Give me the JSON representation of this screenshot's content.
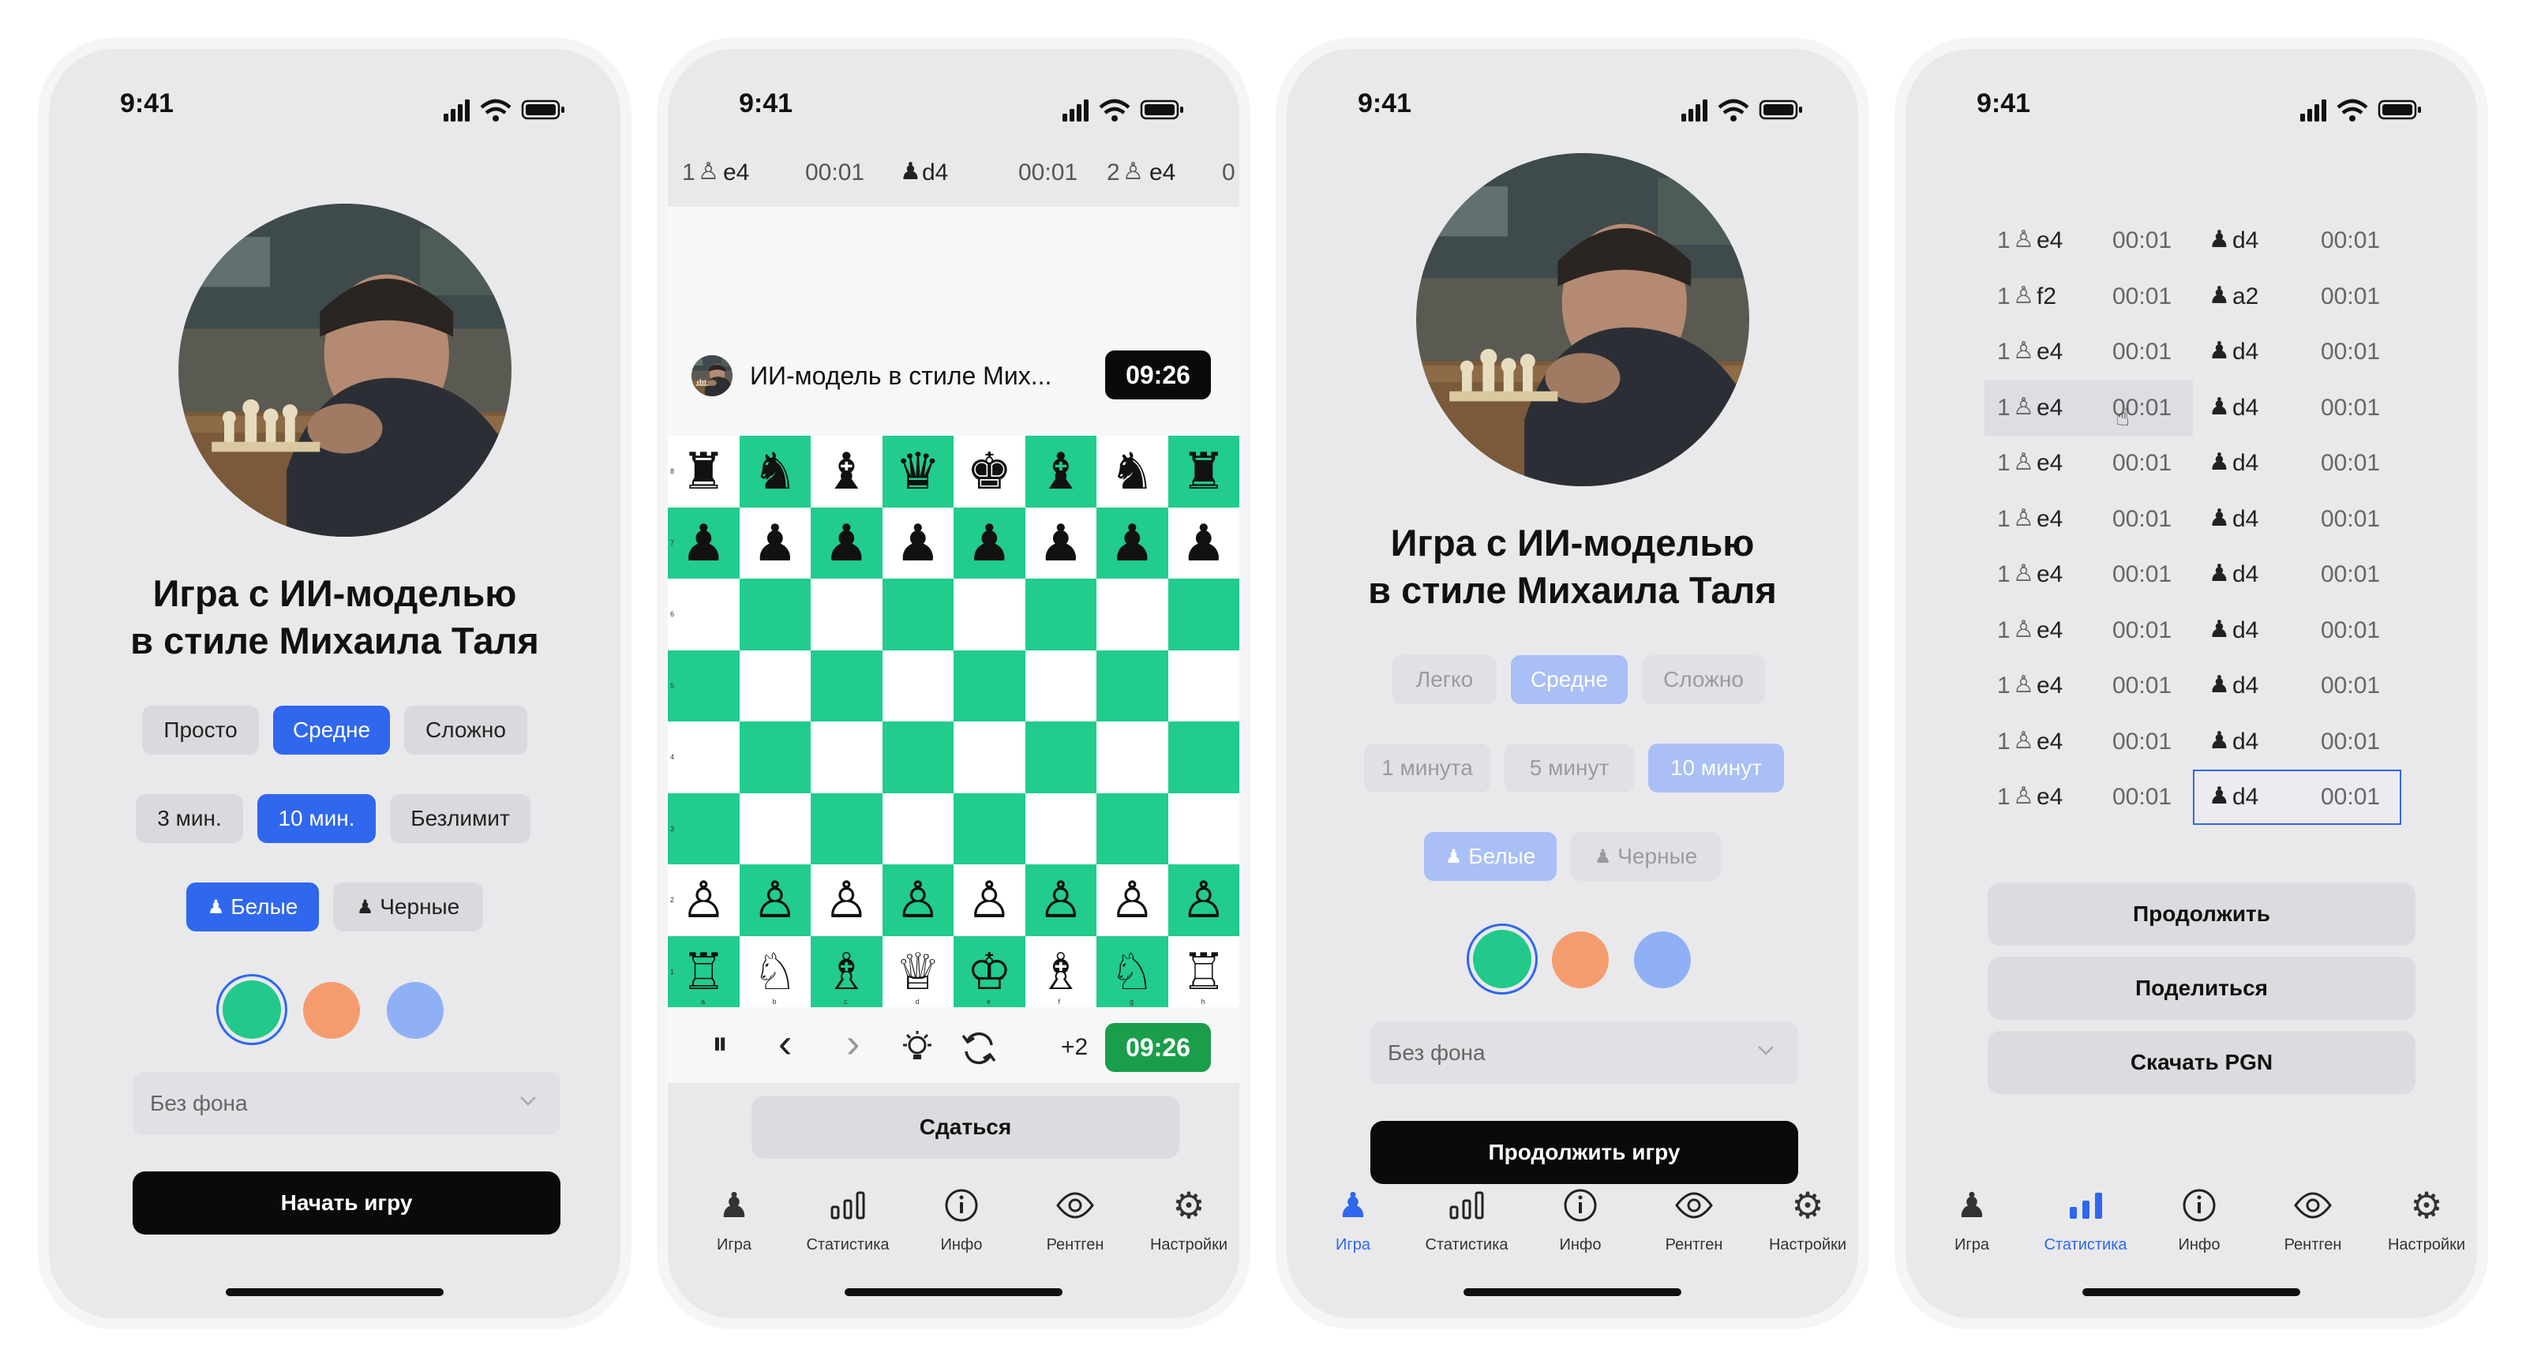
{
  "status_time": "9:41",
  "game_title_line1": "Игра с ИИ-моделью",
  "game_title_line2": "в стиле Михаила Таля",
  "screen1": {
    "difficulty": [
      "Просто",
      "Средне",
      "Сложно"
    ],
    "difficulty_selected": "Средне",
    "time": [
      "3 мин.",
      "10 мин.",
      "Безлимит"
    ],
    "time_selected": "10 мин.",
    "side": [
      "Белые",
      "Черные"
    ],
    "side_selected": "Белые",
    "colors": [
      "#22c98a",
      "#f59c6e",
      "#8fb0f5"
    ],
    "color_selected": "#22c98a",
    "background_placeholder": "Без фона",
    "start_button": "Начать игру"
  },
  "screen2": {
    "move_strip": [
      {
        "num": "1",
        "white": "e4",
        "wtime": "00:01",
        "black": "d4",
        "btime": "00:01"
      },
      {
        "num": "2",
        "white": "e4",
        "wtime": "0"
      }
    ],
    "opponent_name": "ИИ-модель в стиле Мих...",
    "opponent_clock": "09:26",
    "player_clock": "09:26",
    "increment": "+2",
    "board_colors": {
      "light": "#ffffff",
      "dark": "#21cc8d"
    },
    "rows": [
      [
        "♜",
        "♞",
        "♝",
        "♛",
        "♚",
        "♝",
        "♞",
        "♜"
      ],
      [
        "♟",
        "♟",
        "♟",
        "♟",
        "♟",
        "♟",
        "♟",
        "♟"
      ],
      [
        "",
        "",
        "",
        "",
        "",
        "",
        "",
        ""
      ],
      [
        "",
        "",
        "",
        "",
        "",
        "",
        "",
        ""
      ],
      [
        "",
        "",
        "",
        "",
        "",
        "",
        "",
        ""
      ],
      [
        "",
        "",
        "",
        "",
        "",
        "",
        "",
        ""
      ],
      [
        "♙",
        "♙",
        "♙",
        "♙",
        "♙",
        "♙",
        "♙",
        "♙"
      ],
      [
        "♖",
        "♘",
        "♗",
        "♕",
        "♔",
        "♗",
        "♘",
        "♖"
      ]
    ],
    "rank_labels": [
      "8",
      "7",
      "6",
      "5",
      "4",
      "3",
      "2",
      "1"
    ],
    "file_labels": [
      "a",
      "b",
      "c",
      "d",
      "e",
      "f",
      "g",
      "h"
    ],
    "resign_button": "Сдаться"
  },
  "screen3": {
    "difficulty": [
      "Легко",
      "Средне",
      "Сложно"
    ],
    "difficulty_selected": "Средне",
    "time": [
      "1 минута",
      "5 минут",
      "10 минут"
    ],
    "time_selected": "10 минут",
    "side": [
      "Белые",
      "Черные"
    ],
    "side_selected": "Белые",
    "background_placeholder": "Без фона",
    "continue_button": "Продолжить игру"
  },
  "screen4": {
    "moves": [
      {
        "num": "1",
        "white": "e4",
        "wtime": "00:01",
        "black": "d4",
        "btime": "00:01"
      },
      {
        "num": "1",
        "white": "f2",
        "wtime": "00:01",
        "black": "a2",
        "btime": "00:01"
      },
      {
        "num": "1",
        "white": "e4",
        "wtime": "00:01",
        "black": "d4",
        "btime": "00:01"
      },
      {
        "num": "1",
        "white": "e4",
        "wtime": "00:01",
        "black": "d4",
        "btime": "00:01"
      },
      {
        "num": "1",
        "white": "e4",
        "wtime": "00:01",
        "black": "d4",
        "btime": "00:01"
      },
      {
        "num": "1",
        "white": "e4",
        "wtime": "00:01",
        "black": "d4",
        "btime": "00:01"
      },
      {
        "num": "1",
        "white": "e4",
        "wtime": "00:01",
        "black": "d4",
        "btime": "00:01"
      },
      {
        "num": "1",
        "white": "e4",
        "wtime": "00:01",
        "black": "d4",
        "btime": "00:01"
      },
      {
        "num": "1",
        "white": "e4",
        "wtime": "00:01",
        "black": "d4",
        "btime": "00:01"
      },
      {
        "num": "1",
        "white": "e4",
        "wtime": "00:01",
        "black": "d4",
        "btime": "00:01"
      },
      {
        "num": "1",
        "white": "e4",
        "wtime": "00:01",
        "black": "d4",
        "btime": "00:01"
      }
    ],
    "continue_button": "Продолжить",
    "share_button": "Поделиться",
    "download_button": "Скачать PGN"
  },
  "tabs": [
    "Игра",
    "Статистика",
    "Инфо",
    "Рентген",
    "Настройки"
  ],
  "tab_icons": [
    "chess-pawn-icon",
    "bar-chart-icon",
    "info-icon",
    "eye-icon",
    "gear-icon"
  ],
  "accent": "#2f67ee"
}
